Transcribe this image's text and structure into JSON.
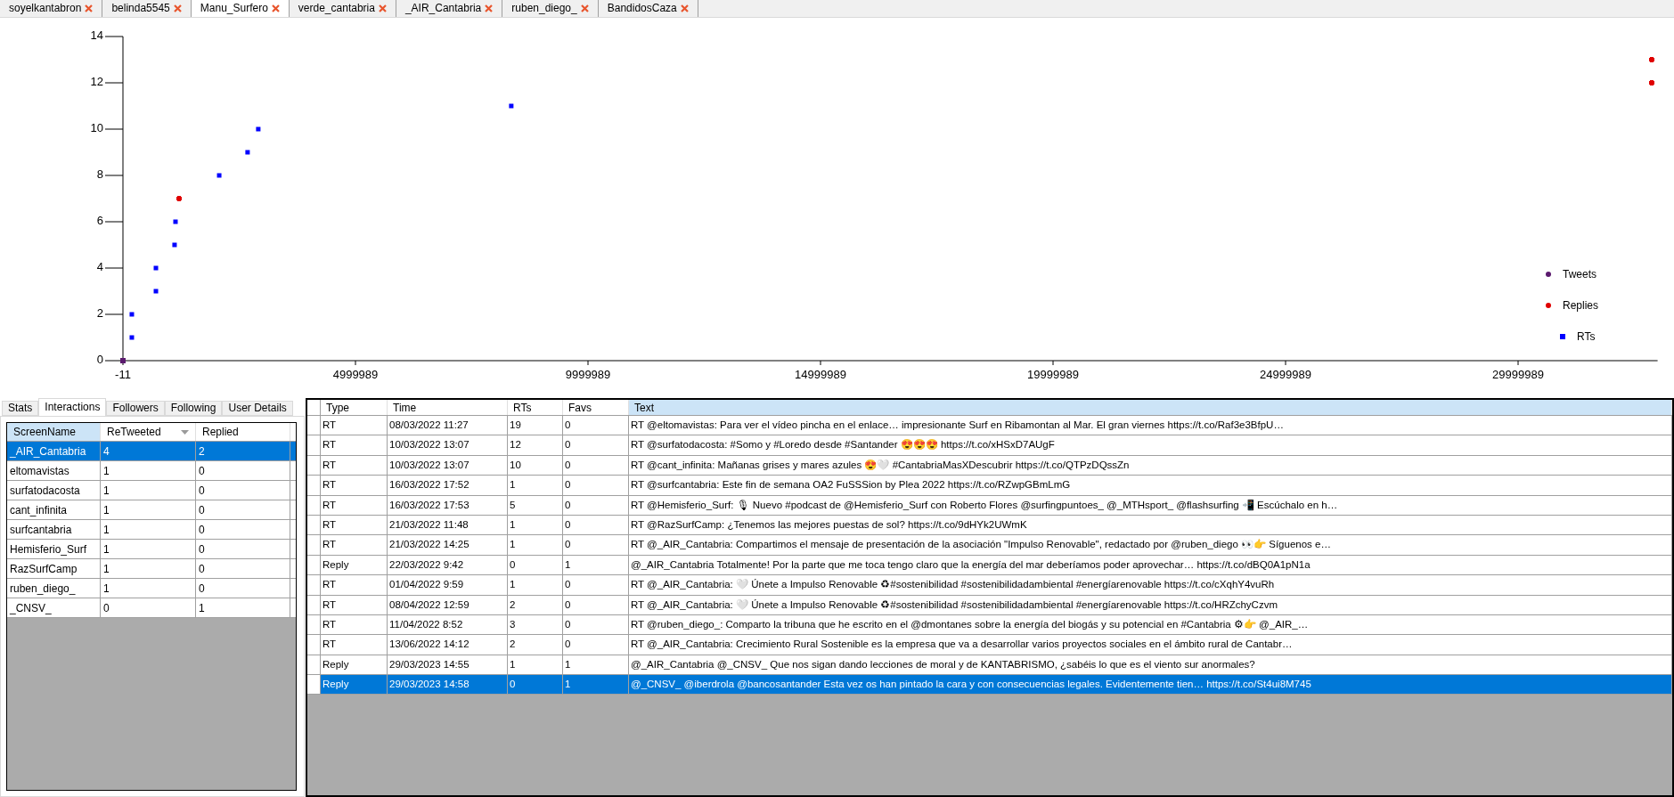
{
  "file_tabs": [
    {
      "label": "soyelkantabron",
      "selected": false
    },
    {
      "label": "belinda5545",
      "selected": false
    },
    {
      "label": "Manu_Surfero",
      "selected": true
    },
    {
      "label": "verde_cantabria",
      "selected": false
    },
    {
      "label": "_AIR_Cantabria",
      "selected": false
    },
    {
      "label": "ruben_diego_",
      "selected": false
    },
    {
      "label": "BandidosCaza",
      "selected": false
    }
  ],
  "chart": {
    "chart_data": {
      "type": "scatter",
      "xlim": [
        -11,
        33000000
      ],
      "ylim": [
        0,
        14
      ],
      "xticks": [
        -11,
        4999989,
        9999989,
        14999989,
        19999989,
        24999989,
        29999989
      ],
      "yticks": [
        0,
        2,
        4,
        6,
        8,
        10,
        12,
        14
      ],
      "legend": "right",
      "series": [
        {
          "name": "Tweets",
          "color": "#5b1a6e",
          "x": [
            -11
          ],
          "values": [
            0
          ]
        },
        {
          "name": "Replies",
          "color": "#e00000",
          "x": [
            1210000,
            32870000,
            32870000
          ],
          "values": [
            7,
            12,
            13
          ]
        },
        {
          "name": "RTs",
          "color": "#0000ff",
          "x": [
            191000,
            191000,
            709000,
            709000,
            1110000,
            1130000,
            2070000,
            2680000,
            2910000,
            8350000
          ],
          "values": [
            1,
            2,
            3,
            4,
            5,
            6,
            8,
            9,
            10,
            11
          ]
        }
      ]
    }
  },
  "panel_tabs": [
    {
      "label": "Stats",
      "selected": false
    },
    {
      "label": "Interactions",
      "selected": true
    },
    {
      "label": "Followers",
      "selected": false
    },
    {
      "label": "Following",
      "selected": false
    },
    {
      "label": "User Details",
      "selected": false
    }
  ],
  "interactions_table": {
    "columns": [
      {
        "label": "ScreenName",
        "highlighted": true,
        "sorted_descending": false
      },
      {
        "label": "ReTweeted",
        "highlighted": false,
        "sorted_descending": true
      },
      {
        "label": "Replied",
        "highlighted": false,
        "sorted_descending": false
      }
    ],
    "rows": [
      {
        "cells": [
          "_AIR_Cantabria",
          "4",
          "2"
        ],
        "selected": true
      },
      {
        "cells": [
          "eltomavistas",
          "1",
          "0"
        ],
        "selected": false
      },
      {
        "cells": [
          "surfatodacosta",
          "1",
          "0"
        ],
        "selected": false
      },
      {
        "cells": [
          "cant_infinita",
          "1",
          "0"
        ],
        "selected": false
      },
      {
        "cells": [
          "surfcantabria",
          "1",
          "0"
        ],
        "selected": false
      },
      {
        "cells": [
          "Hemisferio_Surf",
          "1",
          "0"
        ],
        "selected": false
      },
      {
        "cells": [
          "RazSurfCamp",
          "1",
          "0"
        ],
        "selected": false
      },
      {
        "cells": [
          "ruben_diego_",
          "1",
          "0"
        ],
        "selected": false
      },
      {
        "cells": [
          "_CNSV_",
          "0",
          "1"
        ],
        "selected": false
      }
    ]
  },
  "tweets_table": {
    "columns": [
      {
        "label": "Type",
        "highlighted": false
      },
      {
        "label": "Time",
        "highlighted": false
      },
      {
        "label": "RTs",
        "highlighted": false
      },
      {
        "label": "Favs",
        "highlighted": false
      },
      {
        "label": "Text",
        "highlighted": true
      }
    ],
    "rows": [
      {
        "cells": [
          "RT",
          "08/03/2022 11:27",
          "19",
          "0",
          "RT @eltomavistas: Para ver el vídeo pincha en el enlace… impresionante Surf en Ribamontan al Mar. El gran viernes https://t.co/Raf3e3BfpU…"
        ],
        "selected": false
      },
      {
        "cells": [
          "RT",
          "10/03/2022 13:07",
          "12",
          "0",
          "RT @surfatodacosta: #Somo y #Loredo desde #Santander 😍😍😍 https://t.co/xHSxD7AUgF"
        ],
        "selected": false
      },
      {
        "cells": [
          "RT",
          "10/03/2022 13:07",
          "10",
          "0",
          "RT @cant_infinita: Mañanas grises y mares azules 😍🤍 #CantabriaMasXDescubrir https://t.co/QTPzDQssZn"
        ],
        "selected": false
      },
      {
        "cells": [
          "RT",
          "16/03/2022 17:52",
          "1",
          "0",
          "RT @surfcantabria: Este fin de semana OA2 FuSSSion by Plea 2022 https://t.co/RZwpGBmLmG"
        ],
        "selected": false
      },
      {
        "cells": [
          "RT",
          "16/03/2022 17:53",
          "5",
          "0",
          "RT @Hemisferio_Surf: 🎙 Nuevo #podcast de @Hemisferio_Surf con Roberto Flores @surfingpuntoes_ @_MTHsport_ @flashsurfing 📲 Escúchalo en h…"
        ],
        "selected": false
      },
      {
        "cells": [
          "RT",
          "21/03/2022 11:48",
          "1",
          "0",
          "RT @RazSurfCamp: ¿Tenemos las mejores puestas de sol? https://t.co/9dHYk2UWmK"
        ],
        "selected": false
      },
      {
        "cells": [
          "RT",
          "21/03/2022 14:25",
          "1",
          "0",
          "RT @_AIR_Cantabria: Compartimos el mensaje de presentación de la asociación \"Impulso Renovable\", redactado por @ruben_diego 👀👉 Síguenos e…"
        ],
        "selected": false
      },
      {
        "cells": [
          "Reply",
          "22/03/2022 9:42",
          "0",
          "1",
          "@_AIR_Cantabria Totalmente! Por la parte que me toca tengo claro que la energía del mar deberíamos poder aprovechar… https://t.co/dBQ0A1pN1a"
        ],
        "selected": false
      },
      {
        "cells": [
          "RT",
          "01/04/2022 9:59",
          "1",
          "0",
          "RT @_AIR_Cantabria: 🤍 Únete a Impulso Renovable ♻#sostenibilidad #sostenibilidadambiental #energíarenovable https://t.co/cXqhY4vuRh"
        ],
        "selected": false
      },
      {
        "cells": [
          "RT",
          "08/04/2022 12:59",
          "2",
          "0",
          "RT @_AIR_Cantabria: 🤍 Únete a Impulso Renovable ♻#sostenibilidad #sostenibilidadambiental #energíarenovable https://t.co/HRZchyCzvm"
        ],
        "selected": false
      },
      {
        "cells": [
          "RT",
          "11/04/2022 8:52",
          "3",
          "0",
          "RT @ruben_diego_: Comparto la tribuna que he escrito en el @dmontanes sobre la energía del biogás y su potencial en #Cantabria ⚙👉 @_AIR_…"
        ],
        "selected": false
      },
      {
        "cells": [
          "RT",
          "13/06/2022 14:12",
          "2",
          "0",
          "RT @_AIR_Cantabria: Crecimiento Rural Sostenible es la empresa que va a desarrollar varios proyectos sociales en el ámbito rural de Cantabr…"
        ],
        "selected": false
      },
      {
        "cells": [
          "Reply",
          "29/03/2023 14:55",
          "1",
          "1",
          "@_AIR_Cantabria @_CNSV_ Que nos sigan dando lecciones de moral y de KANTABRISMO, ¿sabéis lo que es el viento sur anormales?"
        ],
        "selected": false
      },
      {
        "cells": [
          "Reply",
          "29/03/2023 14:58",
          "0",
          "1",
          "@_CNSV_ @iberdrola @bancosantander Esta vez os han pintado la cara y con consecuencias legales. Evidentemente tien… https://t.co/St4ui8M745"
        ],
        "selected": true
      }
    ]
  }
}
